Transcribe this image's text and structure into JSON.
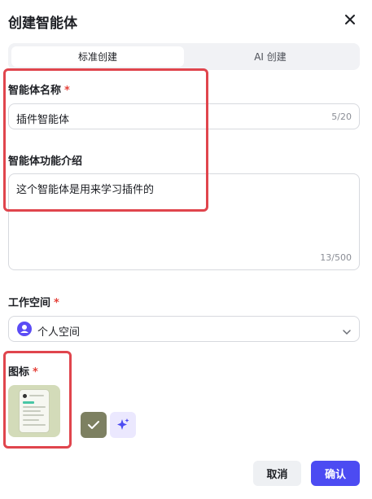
{
  "dialog": {
    "title": "创建智能体",
    "close_icon": "close-icon"
  },
  "tabs": [
    {
      "label": "标准创建",
      "active": true
    },
    {
      "label": "AI 创建",
      "active": false
    }
  ],
  "form": {
    "name": {
      "label": "智能体名称",
      "required_mark": "*",
      "value": "插件智能体",
      "counter": "5/20"
    },
    "description": {
      "label": "智能体功能介绍",
      "value": "这个智能体是用来学习插件的",
      "counter": "13/500"
    },
    "workspace": {
      "label": "工作空间",
      "required_mark": "*",
      "value": "个人空间",
      "icon": "user-avatar-icon",
      "chevron_icon": "chevron-down-icon"
    },
    "icon": {
      "label": "图标",
      "required_mark": "*",
      "options": [
        "check-icon",
        "sparkle-icon"
      ]
    }
  },
  "actions": {
    "cancel_label": "取消",
    "confirm_label": "确认"
  },
  "colors": {
    "accent": "#4c4bf2",
    "required": "#e5423a",
    "highlight": "#e0454d"
  }
}
